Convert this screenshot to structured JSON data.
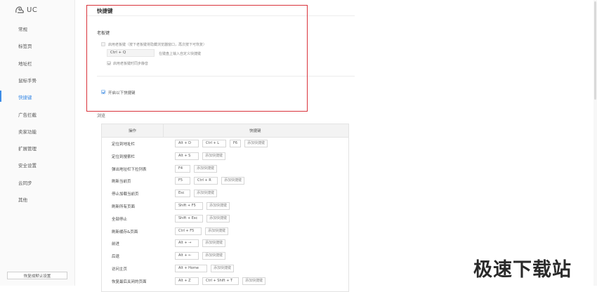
{
  "logo": {
    "text": "UC"
  },
  "sidebar": {
    "items": [
      {
        "label": "常规"
      },
      {
        "label": "标签页"
      },
      {
        "label": "地址栏"
      },
      {
        "label": "鼠标手势"
      },
      {
        "label": "快捷键"
      },
      {
        "label": "广告拦截"
      },
      {
        "label": "卖家功能"
      },
      {
        "label": "扩展管理"
      },
      {
        "label": "安全设置"
      },
      {
        "label": "云同步"
      },
      {
        "label": "其他"
      }
    ],
    "active_index": 4,
    "restore_label": "恢复成默认设置"
  },
  "section": {
    "title": "快捷键",
    "boss_key_heading": "老板键",
    "enable_boss_key_label": "启用老板键",
    "enable_boss_key_hint": "（按下老板键将隐藏浏览器窗口，再次按下可恢复）",
    "shortcut_value": "Ctrl + Q",
    "shortcut_hint": "在键盘上输入自定义快捷键",
    "mute_label": "启用老板键时同步静音",
    "enable_shortcuts_label": "开启以下快捷键"
  },
  "browse": {
    "label": "浏览",
    "col_action": "操作",
    "col_shortcut": "快捷键",
    "add_label": "添加快捷键",
    "rows": [
      {
        "action": "定位到地址栏",
        "keys": [
          "Alt + D",
          "Ctrl + L",
          "F6"
        ]
      },
      {
        "action": "定位到搜索栏",
        "keys": [
          "Alt + S"
        ]
      },
      {
        "action": "弹出地址栏下拉列表",
        "keys": [
          "F4"
        ]
      },
      {
        "action": "刷新当前页",
        "keys": [
          "F5",
          "Ctrl + R"
        ]
      },
      {
        "action": "停止加载当前页",
        "keys": [
          "Esc"
        ]
      },
      {
        "action": "刷新所有页面",
        "keys": [
          "Shift + F5"
        ]
      },
      {
        "action": "全部停止",
        "keys": [
          "Shift + Esc"
        ]
      },
      {
        "action": "刷新缓存&页面",
        "keys": [
          "Ctrl + F5"
        ]
      },
      {
        "action": "前进",
        "keys": [
          "Alt + →"
        ]
      },
      {
        "action": "后退",
        "keys": [
          "Alt + ←"
        ]
      },
      {
        "action": "访问主页",
        "keys": [
          "Alt + Home"
        ]
      },
      {
        "action": "恢复最后关闭的页面",
        "keys": [
          "Alt + Z",
          "Ctrl + Shift + T"
        ]
      }
    ]
  },
  "watermark": {
    "text": "极速下载站"
  },
  "colors": {
    "accent": "#3d8ce6",
    "highlight_box": "#d9333b"
  }
}
